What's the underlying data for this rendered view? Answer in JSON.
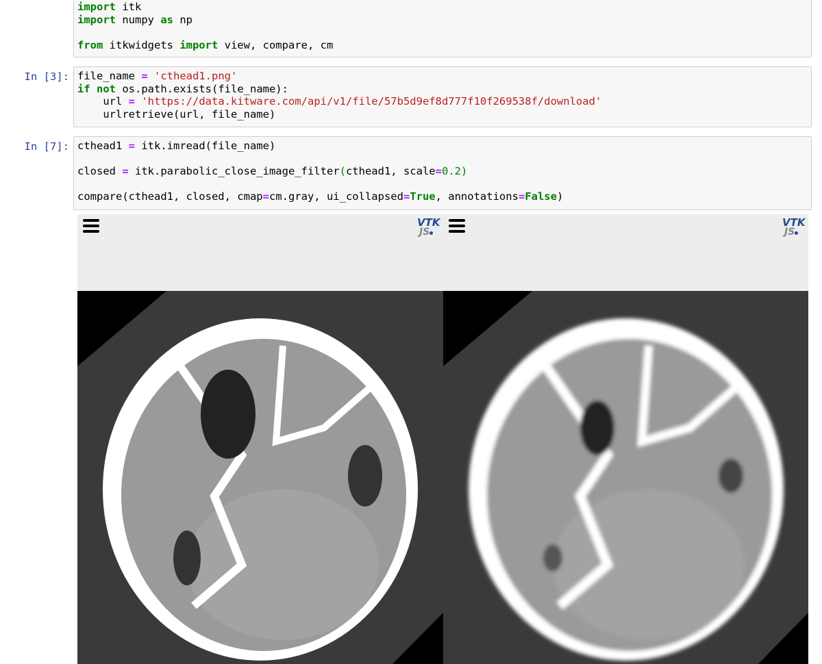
{
  "cells": [
    {
      "prompt": "",
      "lines": [
        [
          [
            "import",
            "kw"
          ],
          [
            " itk",
            ""
          ]
        ],
        [
          [
            "import",
            "kw"
          ],
          [
            " numpy ",
            ""
          ],
          [
            "as",
            "kw"
          ],
          [
            " np",
            ""
          ]
        ],
        [],
        [
          [
            "from",
            "kw"
          ],
          [
            " itkwidgets ",
            ""
          ],
          [
            "import",
            "kw"
          ],
          [
            " view, compare, cm",
            ""
          ]
        ]
      ]
    },
    {
      "prompt": "In [3]:",
      "lines": [
        [
          [
            "file_name ",
            ""
          ],
          [
            "=",
            "op"
          ],
          [
            " ",
            ""
          ],
          [
            "'cthead1.png'",
            "str"
          ]
        ],
        [
          [
            "if",
            "kw"
          ],
          [
            " ",
            ""
          ],
          [
            "not",
            "kw"
          ],
          [
            " os.path.exists(file_name):",
            ""
          ]
        ],
        [
          [
            "    url ",
            ""
          ],
          [
            "=",
            "op"
          ],
          [
            " ",
            ""
          ],
          [
            "'https://data.kitware.com/api/v1/file/57b5d9ef8d777f10f269538f/download'",
            "str"
          ]
        ],
        [
          [
            "    urlretrieve(url, file_name)",
            ""
          ]
        ]
      ]
    },
    {
      "prompt": "In [7]:",
      "lines": [
        [
          [
            "cthead1 ",
            ""
          ],
          [
            "=",
            "op"
          ],
          [
            " itk.imread(file_name)",
            ""
          ]
        ],
        [],
        [
          [
            "closed ",
            ""
          ],
          [
            "=",
            "op"
          ],
          [
            " itk.parabolic_close_image_filter",
            ""
          ],
          [
            "(",
            "par"
          ],
          [
            "cthead1, scale",
            ""
          ],
          [
            "=",
            "op"
          ],
          [
            "0.2",
            "num"
          ],
          [
            ")",
            "par"
          ]
        ],
        [],
        [
          [
            "compare(cthead1, closed, cmap",
            ""
          ],
          [
            "=",
            "op"
          ],
          [
            "cm.gray, ui_collapsed",
            ""
          ],
          [
            "=",
            "op"
          ],
          [
            "True",
            "kw"
          ],
          [
            ", annotations",
            ""
          ],
          [
            "=",
            "op"
          ],
          [
            "False",
            "kw"
          ],
          [
            ")",
            ""
          ]
        ]
      ]
    }
  ],
  "widget": {
    "viewers": [
      {
        "menu_icon": "hamburger-menu-icon",
        "logo": "VTK JS",
        "image": "original"
      },
      {
        "menu_icon": "hamburger-menu-icon",
        "logo": "VTK JS",
        "image": "closed"
      }
    ]
  }
}
